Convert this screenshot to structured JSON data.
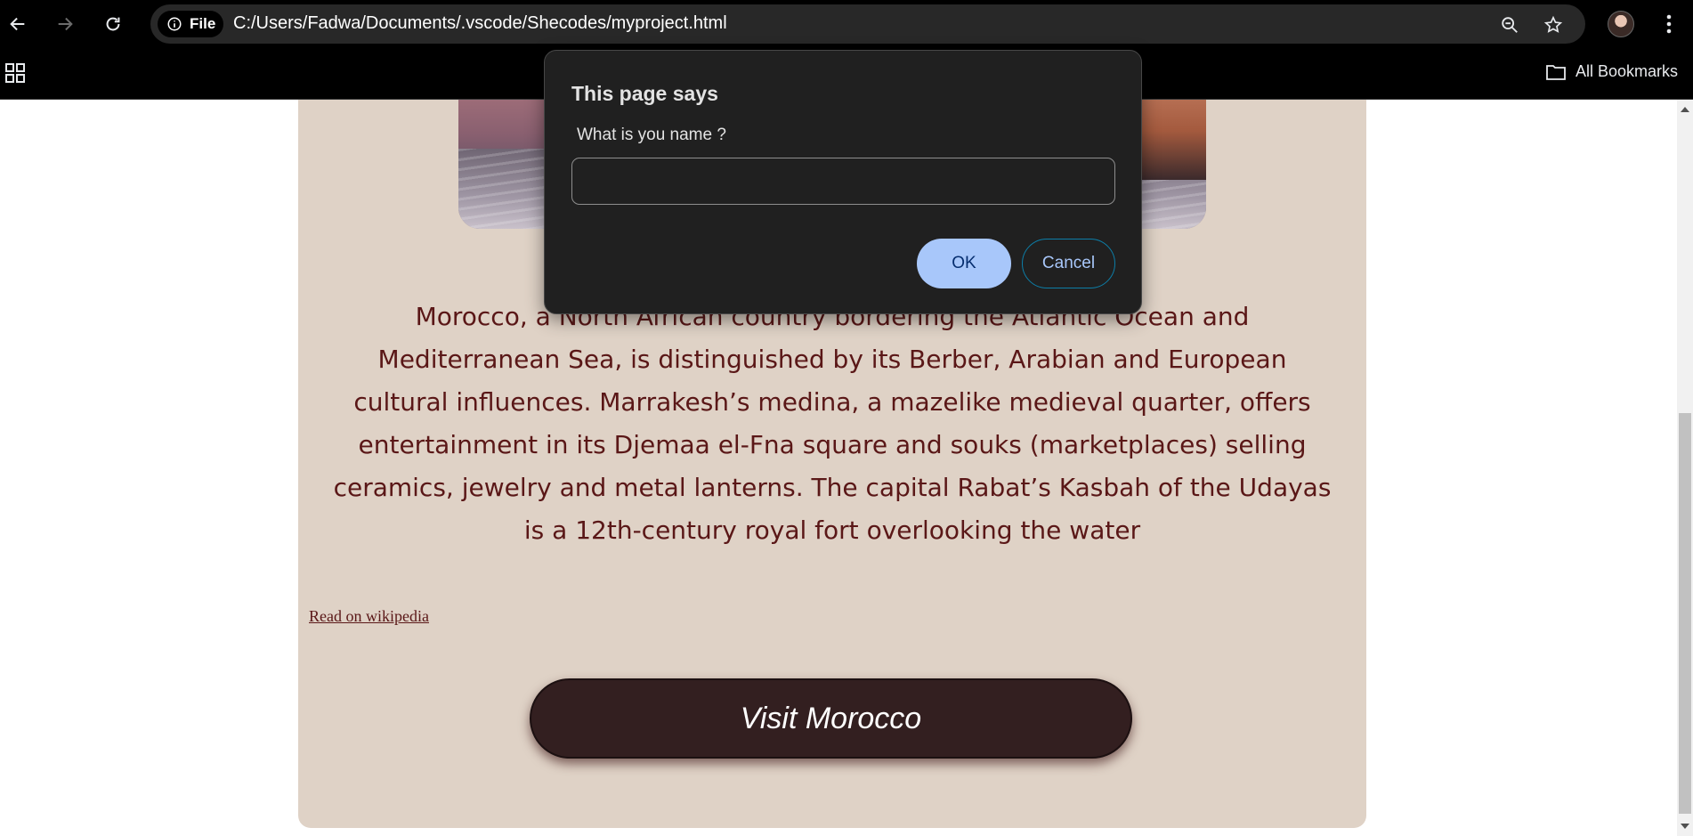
{
  "browser": {
    "site_chip_label": "File",
    "url": "C:/Users/Fadwa/Documents/.vscode/Shecodes/myproject.html",
    "bookmarks_folder_label": "All Bookmarks",
    "icons": [
      "back-icon",
      "forward-icon",
      "reload-icon",
      "info-icon",
      "zoom-icon",
      "star-icon",
      "profile-avatar",
      "more-menu-icon",
      "apps-icon",
      "folder-icon"
    ]
  },
  "page": {
    "description": "Morocco, a North African country bordering the Atlantic Ocean and Mediterranean Sea, is distinguished by its Berber, Arabian and European cultural influences. Marrakesh’s medina, a mazelike medieval quarter, offers entertainment in its Djemaa el-Fna square and souks (marketplaces) selling ceramics, jewelry and metal lanterns. The capital Rabat’s Kasbah of the Udayas is a 12th-century royal fort overlooking the water",
    "wiki_link_label": "Read on wikipedia",
    "visit_button_label": "Visit Morocco",
    "colors": {
      "card_background": "#dfd2c6",
      "text_color": "#5a1717",
      "button_background": "#331f20"
    }
  },
  "dialog": {
    "title": "This page says",
    "message": "What is you name ?",
    "input_value": "",
    "ok_label": "OK",
    "cancel_label": "Cancel",
    "colors": {
      "background": "#202020",
      "ok_background": "#a8c7fa",
      "cancel_text": "#a8c7fa"
    }
  }
}
